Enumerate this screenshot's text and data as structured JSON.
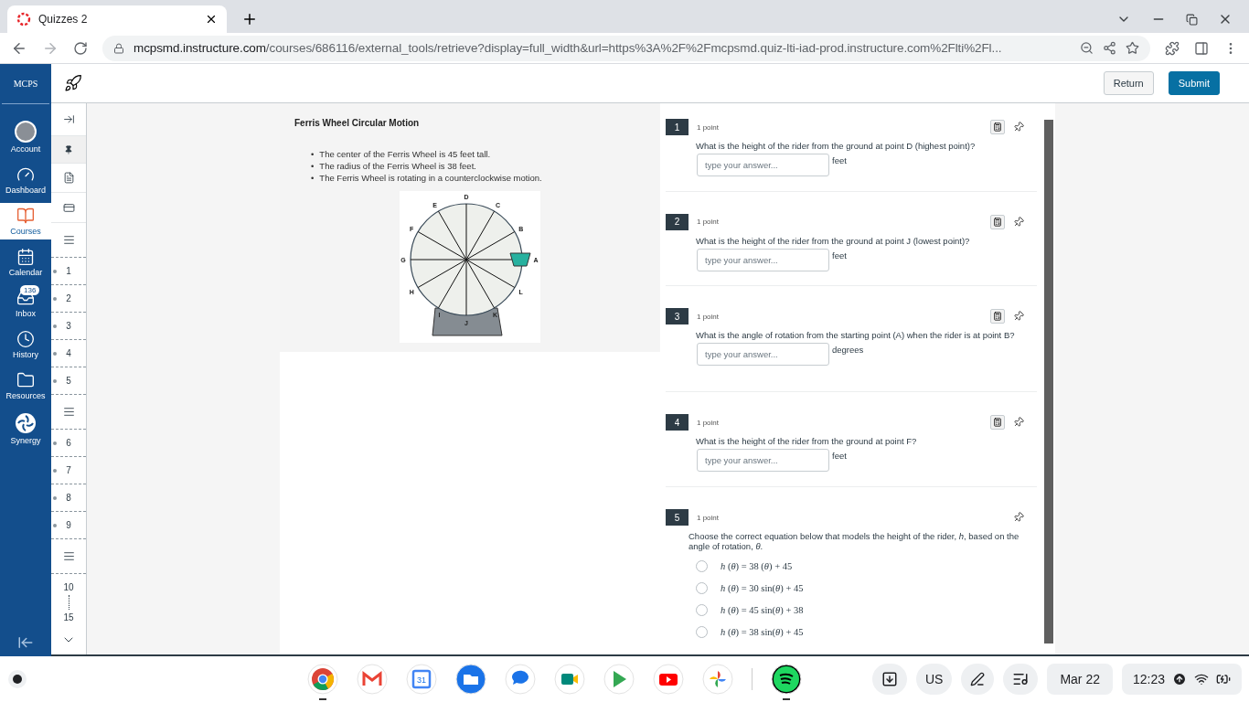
{
  "browser": {
    "tab": {
      "title": "Quizzes 2"
    },
    "address": {
      "domain": "mcpsmd.instructure.com",
      "path": "/courses/686116/external_tools/retrieve?display=full_width&url=https%3A%2F%2Fmcpsmd.quiz-lti-iad-prod.instructure.com%2Flti%2Fl..."
    }
  },
  "global_nav": {
    "logo": "MCPS",
    "items": [
      {
        "label": "Account",
        "kind": "account",
        "selected": false
      },
      {
        "label": "Dashboard",
        "kind": "dashboard",
        "selected": false
      },
      {
        "label": "Courses",
        "kind": "courses",
        "selected": true
      },
      {
        "label": "Calendar",
        "kind": "calendar",
        "selected": false
      },
      {
        "label": "Inbox",
        "kind": "inbox",
        "selected": false,
        "badge": "136"
      },
      {
        "label": "History",
        "kind": "history",
        "selected": false
      },
      {
        "label": "Resources",
        "kind": "resources",
        "selected": false
      },
      {
        "label": "Synergy",
        "kind": "synergy",
        "selected": false
      }
    ]
  },
  "quiz_header": {
    "buttons": [
      {
        "label": "Return",
        "kind": "secondary"
      },
      {
        "label": "Submit",
        "kind": "primary"
      }
    ]
  },
  "question_nav": {
    "items": [
      {
        "kind": "expand"
      },
      {
        "kind": "pin"
      },
      {
        "kind": "passage"
      },
      {
        "kind": "card"
      },
      {
        "kind": "group"
      },
      {
        "kind": "number",
        "label": "1"
      },
      {
        "kind": "number",
        "label": "2"
      },
      {
        "kind": "number",
        "label": "3"
      },
      {
        "kind": "number",
        "label": "4"
      },
      {
        "kind": "number",
        "label": "5"
      },
      {
        "kind": "group"
      },
      {
        "kind": "number",
        "label": "6"
      },
      {
        "kind": "number",
        "label": "7"
      },
      {
        "kind": "number",
        "label": "8"
      },
      {
        "kind": "number",
        "label": "9"
      },
      {
        "kind": "group"
      },
      {
        "kind": "range",
        "from": "10",
        "to": "15"
      },
      {
        "kind": "more"
      }
    ]
  },
  "passage": {
    "title": "Ferris Wheel Circular Motion",
    "bullets": [
      {
        "marker": "•",
        "text": "The center of the Ferris Wheel is 45 feet tall."
      },
      {
        "marker": "•",
        "text": "The radius of the Ferris Wheel is 38 feet."
      },
      {
        "marker": "•",
        "text": "The Ferris Wheel is rotating in a counterclockwise motion."
      }
    ],
    "diagram": {
      "points": [
        "A",
        "B",
        "C",
        "D",
        "E",
        "F",
        "G",
        "H",
        "I",
        "J",
        "K",
        "L"
      ]
    }
  },
  "questions": [
    {
      "number": "1",
      "points": "1 point",
      "kind": "text_entry",
      "calculator": true,
      "prompt": "What is the height of the rider from the ground at point D (highest point)?",
      "placeholder": "type your answer...",
      "unit": "feet"
    },
    {
      "number": "2",
      "points": "1 point",
      "kind": "text_entry",
      "calculator": true,
      "prompt": "What is the height of the rider from the ground at point J (lowest point)?",
      "placeholder": "type your answer...",
      "unit": "feet"
    },
    {
      "number": "3",
      "points": "1 point",
      "kind": "text_entry",
      "calculator": true,
      "prompt": "What is the angle of rotation from the starting point (A) when the rider is at point B?",
      "placeholder": "type your answer...",
      "unit": "degrees"
    },
    {
      "number": "4",
      "points": "1 point",
      "kind": "text_entry",
      "calculator": true,
      "prompt": "What is the height of the rider from the ground at point F?",
      "placeholder": "type your answer...",
      "unit": "feet"
    },
    {
      "number": "5",
      "points": "1 point",
      "kind": "multiple_choice",
      "calculator": false,
      "prompt": "Choose the correct equation below that models the height of the rider, *h*, based on the angle of rotation, *θ*.",
      "options": [
        {
          "label": "*h* (*θ*) = 38 (*θ*) + 45",
          "selected": false
        },
        {
          "label": "*h* (*θ*) = 30 sin(*θ*) + 45",
          "selected": false
        },
        {
          "label": "*h* (*θ*) = 45 sin(*θ*) + 38",
          "selected": false
        },
        {
          "label": "*h* (*θ*) = 38 sin(*θ*) + 45",
          "selected": false
        }
      ]
    }
  ],
  "taskbar": {
    "apps": [
      {
        "kind": "chrome",
        "running": true
      },
      {
        "kind": "gmail",
        "running": false
      },
      {
        "kind": "calendar",
        "running": false,
        "label": "31"
      },
      {
        "kind": "files",
        "running": false
      },
      {
        "kind": "messages",
        "running": false
      },
      {
        "kind": "meet",
        "running": false
      },
      {
        "kind": "play",
        "running": false
      },
      {
        "kind": "youtube",
        "running": false
      },
      {
        "kind": "photos",
        "running": false
      },
      {
        "kind": "spotify",
        "running": true
      }
    ],
    "keyboard": "US",
    "date": "Mar 22",
    "time": "12:23"
  }
}
